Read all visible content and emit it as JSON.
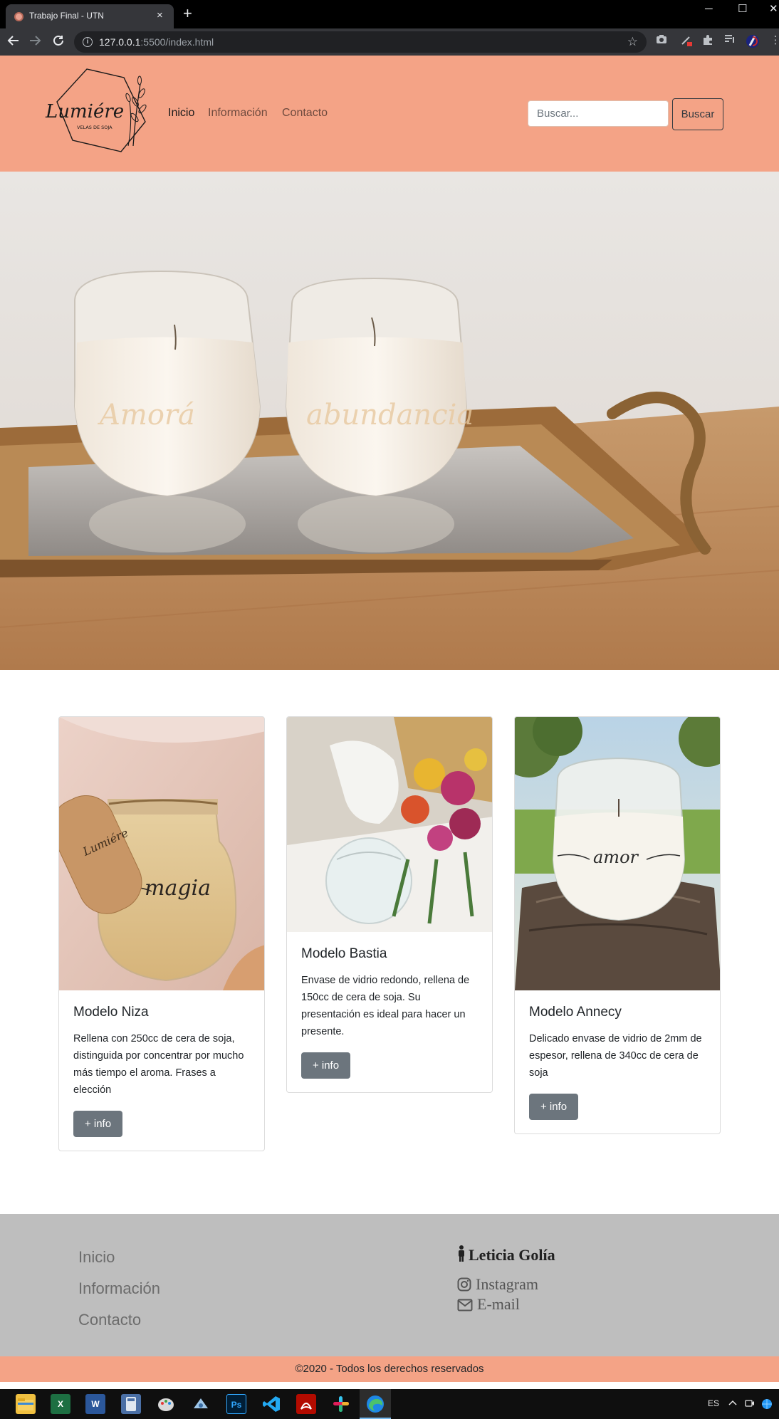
{
  "browser": {
    "tab_title": "Trabajo Final - UTN",
    "tab_close": "×",
    "new_tab": "+",
    "url_host": "127.0.0.1",
    "url_path": ":5500/index.html",
    "controls": {
      "minimize": "─",
      "maximize": "☐",
      "close": "✕"
    },
    "icons": [
      "back-icon",
      "forward-icon",
      "reload-icon",
      "info-icon",
      "star-icon",
      "camera-extension-icon",
      "pen-extension-icon",
      "puzzle-extensions-icon",
      "media-queue-icon",
      "profile-avatar-icon",
      "menu-icon"
    ]
  },
  "header": {
    "logo_text": "Lumiére",
    "logo_subtext": "VELAS DE SOJA",
    "nav": [
      "Inicio",
      "Información",
      "Contacto"
    ],
    "search_placeholder": "Buscar...",
    "search_button": "Buscar",
    "background_color": "#f4a386"
  },
  "cards": [
    {
      "title": "Modelo Niza",
      "text": "Rellena con 250cc de cera de soja, distinguida por concentrar por mucho más tiempo el aroma. Frases a elección",
      "button": "+ info",
      "image_label": "magia",
      "tag_label": "Lumiére"
    },
    {
      "title": "Modelo Bastia",
      "text": "Envase de vidrio redondo, rellena de 150cc de cera de soja. Su presentación es ideal para hacer un presente.",
      "button": "+ info"
    },
    {
      "title": "Modelo Annecy",
      "text": "Delicado envase de vidrio de 2mm de espesor, rellena de 340cc de cera de soja",
      "button": "+ info",
      "image_label": "amor"
    }
  ],
  "footer": {
    "links": [
      "Inicio",
      "Información",
      "Contacto"
    ],
    "author": "Leticia Golía",
    "social": [
      "Instagram",
      "E-mail"
    ],
    "copyright": "©2020 - Todos los derechos reservados"
  },
  "taskbar": {
    "apps": [
      "file-explorer",
      "excel",
      "word",
      "calculator",
      "paint",
      "snipping-tool",
      "photoshop",
      "vscode",
      "acrobat",
      "slack",
      "edge"
    ],
    "language": "ES"
  }
}
